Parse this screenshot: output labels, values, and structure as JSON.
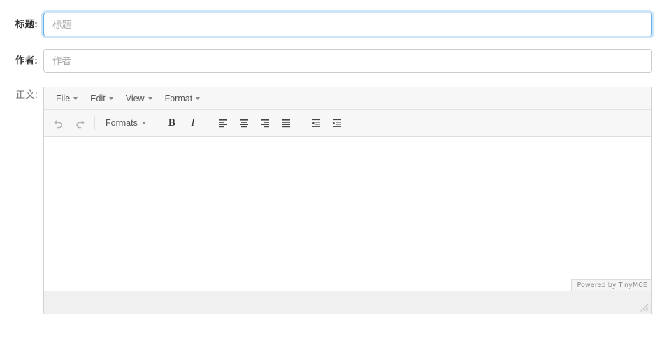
{
  "form": {
    "title_row": {
      "label": "标题:",
      "value": "",
      "placeholder": "标题",
      "focused": true
    },
    "author_row": {
      "label": "作者:",
      "value": "",
      "placeholder": "作者",
      "focused": false
    },
    "body_row": {
      "label": "正文:"
    }
  },
  "editor": {
    "menubar": [
      {
        "label": "File",
        "icon": "chevron-down-icon"
      },
      {
        "label": "Edit",
        "icon": "chevron-down-icon"
      },
      {
        "label": "View",
        "icon": "chevron-down-icon"
      },
      {
        "label": "Format",
        "icon": "chevron-down-icon"
      }
    ],
    "toolbar": {
      "undo": {
        "name": "undo-icon",
        "title": "Undo",
        "disabled": true
      },
      "redo": {
        "name": "redo-icon",
        "title": "Redo",
        "disabled": true
      },
      "formats": {
        "label": "Formats",
        "icon": "chevron-down-icon"
      },
      "bold": {
        "label": "B",
        "title": "Bold"
      },
      "italic": {
        "label": "I",
        "title": "Italic"
      },
      "align_left": {
        "name": "align-left-icon",
        "title": "Align left"
      },
      "align_center": {
        "name": "align-center-icon",
        "title": "Align center"
      },
      "align_right": {
        "name": "align-right-icon",
        "title": "Align right"
      },
      "align_justify": {
        "name": "align-justify-icon",
        "title": "Justify"
      },
      "outdent": {
        "name": "outdent-icon",
        "title": "Decrease indent"
      },
      "indent": {
        "name": "indent-icon",
        "title": "Increase indent"
      }
    },
    "content": "",
    "badge": "Powered by TinyMCE",
    "resize_handle": "resize-grip-icon"
  },
  "colors": {
    "focus_border": "#66afe9",
    "input_border": "#cccccc",
    "toolbar_bg": "#f7f7f7",
    "statusbar_bg": "#f0f0f0"
  }
}
